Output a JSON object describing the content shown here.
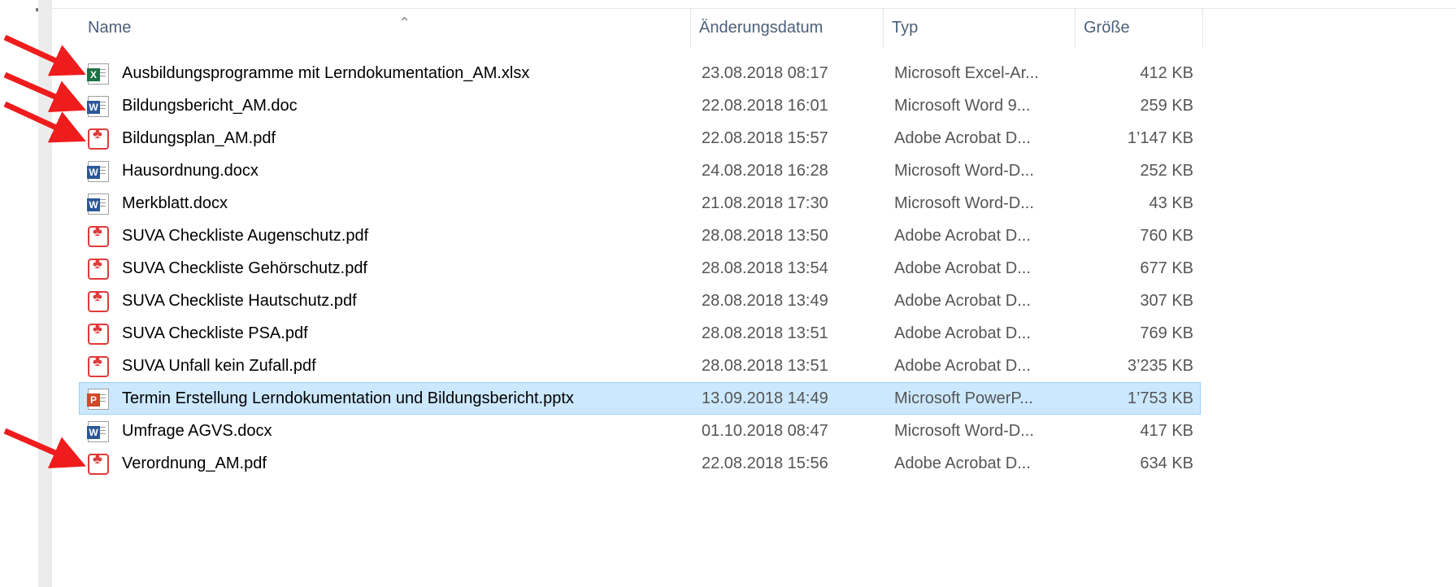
{
  "columns": {
    "name": "Name",
    "date": "Änderungsdatum",
    "type": "Typ",
    "size": "Größe"
  },
  "files": [
    {
      "name": "Ausbildungsprogramme mit Lerndokumentation_AM.xlsx",
      "date": "23.08.2018 08:17",
      "type": "Microsoft Excel-Ar...",
      "size": "412 KB",
      "icon": "excel-icon",
      "selected": false
    },
    {
      "name": "Bildungsbericht_AM.doc",
      "date": "22.08.2018 16:01",
      "type": "Microsoft Word 9...",
      "size": "259 KB",
      "icon": "word-icon",
      "selected": false
    },
    {
      "name": "Bildungsplan_AM.pdf",
      "date": "22.08.2018 15:57",
      "type": "Adobe Acrobat D...",
      "size": "1’147 KB",
      "icon": "pdf-icon",
      "selected": false
    },
    {
      "name": "Hausordnung.docx",
      "date": "24.08.2018 16:28",
      "type": "Microsoft Word-D...",
      "size": "252 KB",
      "icon": "word-icon",
      "selected": false
    },
    {
      "name": "Merkblatt.docx",
      "date": "21.08.2018 17:30",
      "type": "Microsoft Word-D...",
      "size": "43 KB",
      "icon": "word-icon",
      "selected": false
    },
    {
      "name": "SUVA Checkliste Augenschutz.pdf",
      "date": "28.08.2018 13:50",
      "type": "Adobe Acrobat D...",
      "size": "760 KB",
      "icon": "pdf-icon",
      "selected": false
    },
    {
      "name": "SUVA Checkliste Gehörschutz.pdf",
      "date": "28.08.2018 13:54",
      "type": "Adobe Acrobat D...",
      "size": "677 KB",
      "icon": "pdf-icon",
      "selected": false
    },
    {
      "name": "SUVA Checkliste Hautschutz.pdf",
      "date": "28.08.2018 13:49",
      "type": "Adobe Acrobat D...",
      "size": "307 KB",
      "icon": "pdf-icon",
      "selected": false
    },
    {
      "name": "SUVA Checkliste PSA.pdf",
      "date": "28.08.2018 13:51",
      "type": "Adobe Acrobat D...",
      "size": "769 KB",
      "icon": "pdf-icon",
      "selected": false
    },
    {
      "name": "SUVA Unfall kein Zufall.pdf",
      "date": "28.08.2018 13:51",
      "type": "Adobe Acrobat D...",
      "size": "3’235 KB",
      "icon": "pdf-icon",
      "selected": false
    },
    {
      "name": "Termin Erstellung Lerndokumentation und Bildungsbericht.pptx",
      "date": "13.09.2018 14:49",
      "type": "Microsoft PowerP...",
      "size": "1’753 KB",
      "icon": "powerpoint-icon",
      "selected": true
    },
    {
      "name": "Umfrage AGVS.docx",
      "date": "01.10.2018 08:47",
      "type": "Microsoft Word-D...",
      "size": "417 KB",
      "icon": "word-icon",
      "selected": false
    },
    {
      "name": "Verordnung_AM.pdf",
      "date": "22.08.2018 15:56",
      "type": "Adobe Acrobat D...",
      "size": "634 KB",
      "icon": "pdf-icon",
      "selected": false
    }
  ],
  "annotations": {
    "arrow_color": "#ee1c1c",
    "highlighted_files": [
      "Ausbildungsprogramme mit Lerndokumentation_AM.xlsx",
      "Bildungsbericht_AM.doc",
      "Bildungsplan_AM.pdf",
      "Verordnung_AM.pdf"
    ]
  },
  "colors": {
    "header_text": "#4c607a",
    "selection_bg": "#cce8ff",
    "selection_border": "#99d1ff"
  }
}
